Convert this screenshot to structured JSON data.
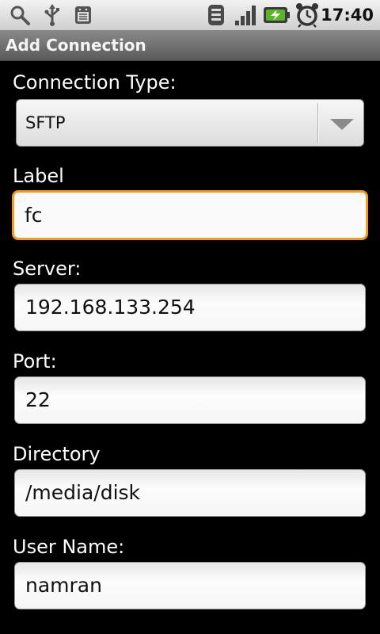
{
  "status_bar": {
    "time": "17:40",
    "left_icons": [
      "search-icon",
      "usb-icon",
      "android-debug-icon"
    ],
    "right_icons": [
      "wifi-icon",
      "signal-icon",
      "battery-charging-icon",
      "alarm-clock-icon"
    ]
  },
  "title_bar": {
    "title": "Add Connection"
  },
  "form": {
    "connection_type": {
      "label": "Connection Type:",
      "value": "SFTP"
    },
    "label_field": {
      "label": "Label",
      "value": "fc"
    },
    "server": {
      "label": "Server:",
      "value": "192.168.133.254"
    },
    "port": {
      "label": "Port:",
      "value": "22"
    },
    "directory": {
      "label": "Directory",
      "value": "/media/disk"
    },
    "user_name": {
      "label": "User Name:",
      "value": "namran"
    }
  },
  "colors": {
    "focus": "#f39a1a",
    "background": "#000000"
  }
}
